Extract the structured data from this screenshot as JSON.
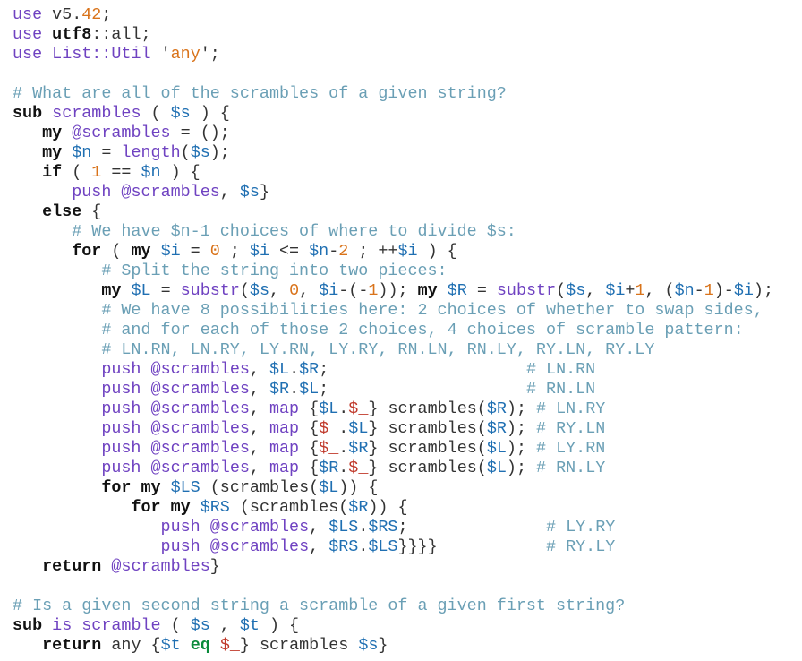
{
  "colors": {
    "background": "#ffffff",
    "plain": "#333333",
    "keyword": "#111111",
    "function": "#6f42c1",
    "variable": "#1f6fb2",
    "number": "#d9731a",
    "string": "#c0392b",
    "comment": "#6a9fb5",
    "special_var": "#c0392b",
    "operator_word": "#0a8a3a"
  },
  "lines": [
    [
      [
        "use",
        "function"
      ],
      [
        " v5.",
        "plain"
      ],
      [
        "42",
        "number"
      ],
      [
        ";",
        "plain"
      ]
    ],
    [
      [
        "use",
        "function"
      ],
      [
        " ",
        "plain"
      ],
      [
        "utf8",
        "keyword_bold"
      ],
      [
        "::all;",
        "plain"
      ]
    ],
    [
      [
        "use",
        "function"
      ],
      [
        " ",
        "plain"
      ],
      [
        "List::Util",
        "function"
      ],
      [
        " ",
        "plain"
      ],
      [
        "'",
        "plain"
      ],
      [
        "any",
        "number"
      ],
      [
        "'",
        "plain"
      ],
      [
        ";",
        "plain"
      ]
    ],
    [],
    [
      [
        "# What are all of the scrambles of a given string?",
        "comment"
      ]
    ],
    [
      [
        "sub",
        "keyword_bold"
      ],
      [
        " ",
        "plain"
      ],
      [
        "scrambles",
        "function"
      ],
      [
        " ( ",
        "plain"
      ],
      [
        "$s",
        "variable"
      ],
      [
        " ) {",
        "plain"
      ]
    ],
    [
      [
        "   ",
        "plain"
      ],
      [
        "my",
        "keyword_bold"
      ],
      [
        " ",
        "plain"
      ],
      [
        "@scrambles",
        "function"
      ],
      [
        " = ();",
        "plain"
      ]
    ],
    [
      [
        "   ",
        "plain"
      ],
      [
        "my",
        "keyword_bold"
      ],
      [
        " ",
        "plain"
      ],
      [
        "$n",
        "variable"
      ],
      [
        " = ",
        "plain"
      ],
      [
        "length",
        "function"
      ],
      [
        "(",
        "plain"
      ],
      [
        "$s",
        "variable"
      ],
      [
        ");",
        "plain"
      ]
    ],
    [
      [
        "   ",
        "plain"
      ],
      [
        "if",
        "keyword_bold"
      ],
      [
        " ( ",
        "plain"
      ],
      [
        "1",
        "number"
      ],
      [
        " == ",
        "plain"
      ],
      [
        "$n",
        "variable"
      ],
      [
        " ) {",
        "plain"
      ]
    ],
    [
      [
        "      ",
        "plain"
      ],
      [
        "push",
        "function"
      ],
      [
        " ",
        "plain"
      ],
      [
        "@scrambles",
        "function"
      ],
      [
        ", ",
        "plain"
      ],
      [
        "$s",
        "variable"
      ],
      [
        "}",
        "plain"
      ]
    ],
    [
      [
        "   ",
        "plain"
      ],
      [
        "else",
        "keyword_bold"
      ],
      [
        " {",
        "plain"
      ]
    ],
    [
      [
        "      ",
        "plain"
      ],
      [
        "# We have $n-1 choices of where to divide $s:",
        "comment"
      ]
    ],
    [
      [
        "      ",
        "plain"
      ],
      [
        "for",
        "keyword_bold"
      ],
      [
        " ( ",
        "plain"
      ],
      [
        "my",
        "keyword_bold"
      ],
      [
        " ",
        "plain"
      ],
      [
        "$i",
        "variable"
      ],
      [
        " = ",
        "plain"
      ],
      [
        "0",
        "number"
      ],
      [
        " ; ",
        "plain"
      ],
      [
        "$i",
        "variable"
      ],
      [
        " <= ",
        "plain"
      ],
      [
        "$n",
        "variable"
      ],
      [
        "-",
        "plain"
      ],
      [
        "2",
        "number"
      ],
      [
        " ; ++",
        "plain"
      ],
      [
        "$i",
        "variable"
      ],
      [
        " ) {",
        "plain"
      ]
    ],
    [
      [
        "         ",
        "plain"
      ],
      [
        "# Split the string into two pieces:",
        "comment"
      ]
    ],
    [
      [
        "         ",
        "plain"
      ],
      [
        "my",
        "keyword_bold"
      ],
      [
        " ",
        "plain"
      ],
      [
        "$L",
        "variable"
      ],
      [
        " = ",
        "plain"
      ],
      [
        "substr",
        "function"
      ],
      [
        "(",
        "plain"
      ],
      [
        "$s",
        "variable"
      ],
      [
        ", ",
        "plain"
      ],
      [
        "0",
        "number"
      ],
      [
        ", ",
        "plain"
      ],
      [
        "$i",
        "variable"
      ],
      [
        "-(-",
        "plain"
      ],
      [
        "1",
        "number"
      ],
      [
        ")); ",
        "plain"
      ],
      [
        "my",
        "keyword_bold"
      ],
      [
        " ",
        "plain"
      ],
      [
        "$R",
        "variable"
      ],
      [
        " = ",
        "plain"
      ],
      [
        "substr",
        "function"
      ],
      [
        "(",
        "plain"
      ],
      [
        "$s",
        "variable"
      ],
      [
        ", ",
        "plain"
      ],
      [
        "$i",
        "variable"
      ],
      [
        "+",
        "plain"
      ],
      [
        "1",
        "number"
      ],
      [
        ", (",
        "plain"
      ],
      [
        "$n",
        "variable"
      ],
      [
        "-",
        "plain"
      ],
      [
        "1",
        "number"
      ],
      [
        ")-",
        "plain"
      ],
      [
        "$i",
        "variable"
      ],
      [
        ");",
        "plain"
      ]
    ],
    [
      [
        "         ",
        "plain"
      ],
      [
        "# We have 8 possibilities here: 2 choices of whether to swap sides,",
        "comment"
      ]
    ],
    [
      [
        "         ",
        "plain"
      ],
      [
        "# and for each of those 2 choices, 4 choices of scramble pattern:",
        "comment"
      ]
    ],
    [
      [
        "         ",
        "plain"
      ],
      [
        "# LN.RN, LN.RY, LY.RN, LY.RY, RN.LN, RN.LY, RY.LN, RY.LY",
        "comment"
      ]
    ],
    [
      [
        "         ",
        "plain"
      ],
      [
        "push",
        "function"
      ],
      [
        " ",
        "plain"
      ],
      [
        "@scrambles",
        "function"
      ],
      [
        ", ",
        "plain"
      ],
      [
        "$L",
        "variable"
      ],
      [
        ".",
        "plain"
      ],
      [
        "$R",
        "variable"
      ],
      [
        ";",
        "plain"
      ],
      [
        "                    ",
        "plain"
      ],
      [
        "# LN.RN",
        "comment"
      ]
    ],
    [
      [
        "         ",
        "plain"
      ],
      [
        "push",
        "function"
      ],
      [
        " ",
        "plain"
      ],
      [
        "@scrambles",
        "function"
      ],
      [
        ", ",
        "plain"
      ],
      [
        "$R",
        "variable"
      ],
      [
        ".",
        "plain"
      ],
      [
        "$L",
        "variable"
      ],
      [
        ";",
        "plain"
      ],
      [
        "                    ",
        "plain"
      ],
      [
        "# RN.LN",
        "comment"
      ]
    ],
    [
      [
        "         ",
        "plain"
      ],
      [
        "push",
        "function"
      ],
      [
        " ",
        "plain"
      ],
      [
        "@scrambles",
        "function"
      ],
      [
        ", ",
        "plain"
      ],
      [
        "map",
        "function"
      ],
      [
        " {",
        "plain"
      ],
      [
        "$L",
        "variable"
      ],
      [
        ".",
        "plain"
      ],
      [
        "$_",
        "special_var"
      ],
      [
        "} ",
        "plain"
      ],
      [
        "scrambles",
        "plain"
      ],
      [
        "(",
        "plain"
      ],
      [
        "$R",
        "variable"
      ],
      [
        "); ",
        "plain"
      ],
      [
        "# LN.RY",
        "comment"
      ]
    ],
    [
      [
        "         ",
        "plain"
      ],
      [
        "push",
        "function"
      ],
      [
        " ",
        "plain"
      ],
      [
        "@scrambles",
        "function"
      ],
      [
        ", ",
        "plain"
      ],
      [
        "map",
        "function"
      ],
      [
        " {",
        "plain"
      ],
      [
        "$_",
        "special_var"
      ],
      [
        ".",
        "plain"
      ],
      [
        "$L",
        "variable"
      ],
      [
        "} ",
        "plain"
      ],
      [
        "scrambles",
        "plain"
      ],
      [
        "(",
        "plain"
      ],
      [
        "$R",
        "variable"
      ],
      [
        "); ",
        "plain"
      ],
      [
        "# RY.LN",
        "comment"
      ]
    ],
    [
      [
        "         ",
        "plain"
      ],
      [
        "push",
        "function"
      ],
      [
        " ",
        "plain"
      ],
      [
        "@scrambles",
        "function"
      ],
      [
        ", ",
        "plain"
      ],
      [
        "map",
        "function"
      ],
      [
        " {",
        "plain"
      ],
      [
        "$_",
        "special_var"
      ],
      [
        ".",
        "plain"
      ],
      [
        "$R",
        "variable"
      ],
      [
        "} ",
        "plain"
      ],
      [
        "scrambles",
        "plain"
      ],
      [
        "(",
        "plain"
      ],
      [
        "$L",
        "variable"
      ],
      [
        "); ",
        "plain"
      ],
      [
        "# LY.RN",
        "comment"
      ]
    ],
    [
      [
        "         ",
        "plain"
      ],
      [
        "push",
        "function"
      ],
      [
        " ",
        "plain"
      ],
      [
        "@scrambles",
        "function"
      ],
      [
        ", ",
        "plain"
      ],
      [
        "map",
        "function"
      ],
      [
        " {",
        "plain"
      ],
      [
        "$R",
        "variable"
      ],
      [
        ".",
        "plain"
      ],
      [
        "$_",
        "special_var"
      ],
      [
        "} ",
        "plain"
      ],
      [
        "scrambles",
        "plain"
      ],
      [
        "(",
        "plain"
      ],
      [
        "$L",
        "variable"
      ],
      [
        "); ",
        "plain"
      ],
      [
        "# RN.LY",
        "comment"
      ]
    ],
    [
      [
        "         ",
        "plain"
      ],
      [
        "for",
        "keyword_bold"
      ],
      [
        " ",
        "plain"
      ],
      [
        "my",
        "keyword_bold"
      ],
      [
        " ",
        "plain"
      ],
      [
        "$LS",
        "variable"
      ],
      [
        " (",
        "plain"
      ],
      [
        "scrambles",
        "plain"
      ],
      [
        "(",
        "plain"
      ],
      [
        "$L",
        "variable"
      ],
      [
        ")) {",
        "plain"
      ]
    ],
    [
      [
        "            ",
        "plain"
      ],
      [
        "for",
        "keyword_bold"
      ],
      [
        " ",
        "plain"
      ],
      [
        "my",
        "keyword_bold"
      ],
      [
        " ",
        "plain"
      ],
      [
        "$RS",
        "variable"
      ],
      [
        " (",
        "plain"
      ],
      [
        "scrambles",
        "plain"
      ],
      [
        "(",
        "plain"
      ],
      [
        "$R",
        "variable"
      ],
      [
        ")) {",
        "plain"
      ]
    ],
    [
      [
        "               ",
        "plain"
      ],
      [
        "push",
        "function"
      ],
      [
        " ",
        "plain"
      ],
      [
        "@scrambles",
        "function"
      ],
      [
        ", ",
        "plain"
      ],
      [
        "$LS",
        "variable"
      ],
      [
        ".",
        "plain"
      ],
      [
        "$RS",
        "variable"
      ],
      [
        ";",
        "plain"
      ],
      [
        "              ",
        "plain"
      ],
      [
        "# LY.RY",
        "comment"
      ]
    ],
    [
      [
        "               ",
        "plain"
      ],
      [
        "push",
        "function"
      ],
      [
        " ",
        "plain"
      ],
      [
        "@scrambles",
        "function"
      ],
      [
        ", ",
        "plain"
      ],
      [
        "$RS",
        "variable"
      ],
      [
        ".",
        "plain"
      ],
      [
        "$LS",
        "variable"
      ],
      [
        "}}}}",
        "plain"
      ],
      [
        "           ",
        "plain"
      ],
      [
        "# RY.LY",
        "comment"
      ]
    ],
    [
      [
        "   ",
        "plain"
      ],
      [
        "return",
        "keyword_bold"
      ],
      [
        " ",
        "plain"
      ],
      [
        "@scrambles",
        "function"
      ],
      [
        "}",
        "plain"
      ]
    ],
    [],
    [
      [
        "# Is a given second string a scramble of a given first string?",
        "comment"
      ]
    ],
    [
      [
        "sub",
        "keyword_bold"
      ],
      [
        " ",
        "plain"
      ],
      [
        "is_scramble",
        "function"
      ],
      [
        " ( ",
        "plain"
      ],
      [
        "$s",
        "variable"
      ],
      [
        " , ",
        "plain"
      ],
      [
        "$t",
        "variable"
      ],
      [
        " ) {",
        "plain"
      ]
    ],
    [
      [
        "   ",
        "plain"
      ],
      [
        "return",
        "keyword_bold"
      ],
      [
        " ",
        "plain"
      ],
      [
        "any",
        "plain"
      ],
      [
        " {",
        "plain"
      ],
      [
        "$t",
        "variable"
      ],
      [
        " ",
        "plain"
      ],
      [
        "eq",
        "operator_word"
      ],
      [
        " ",
        "plain"
      ],
      [
        "$_",
        "special_var"
      ],
      [
        "} ",
        "plain"
      ],
      [
        "scrambles",
        "plain"
      ],
      [
        " ",
        "plain"
      ],
      [
        "$s",
        "variable"
      ],
      [
        "}",
        "plain"
      ]
    ]
  ]
}
